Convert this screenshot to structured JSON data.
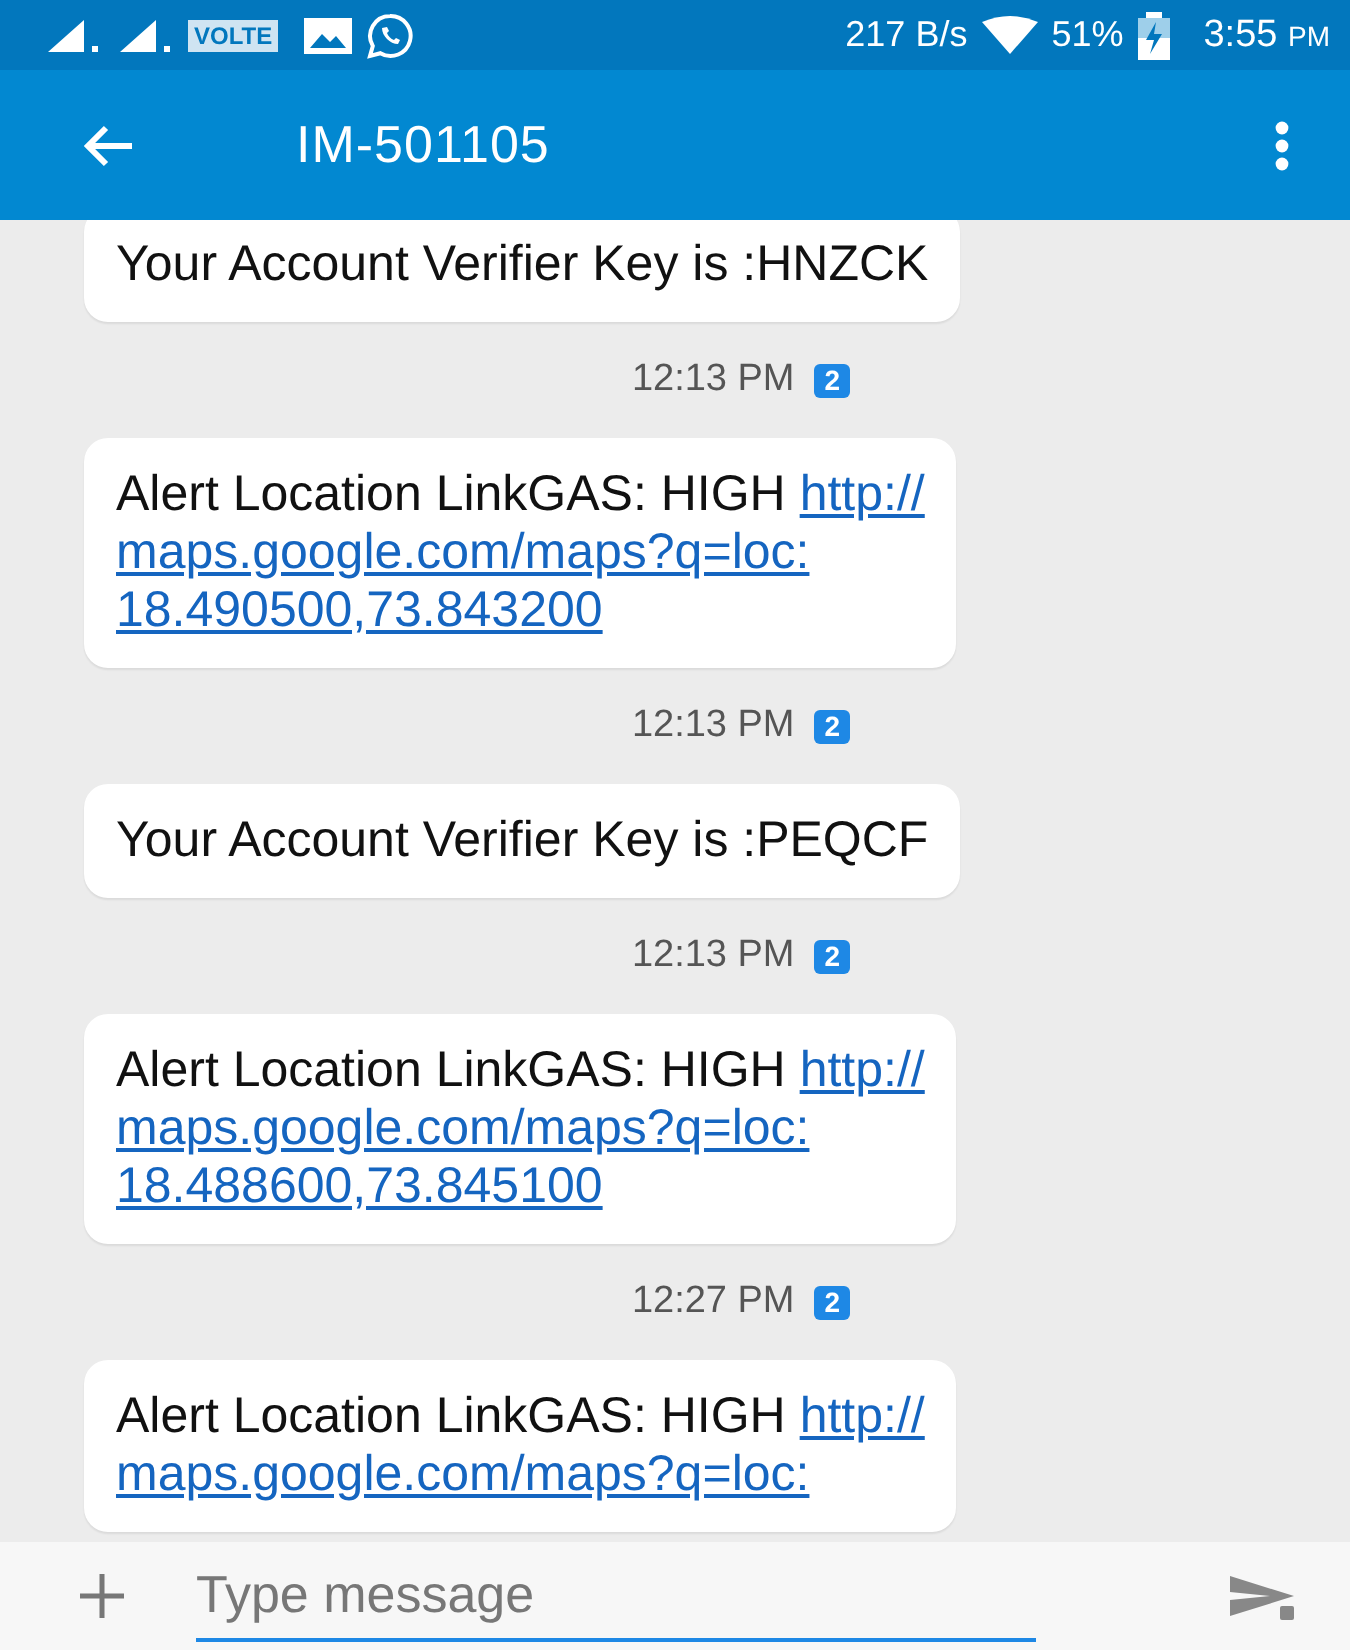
{
  "status_bar": {
    "network": "VOLTE",
    "speed": "217 B/s",
    "battery": "51%",
    "time": "3:55",
    "meridiem": "PM"
  },
  "toolbar": {
    "title": "IM-501105"
  },
  "conversation": [
    {
      "kind": "message",
      "text": "Your Account Verifier Key is :HNZCK"
    },
    {
      "kind": "timestamp",
      "time": "12:13 PM",
      "sim": "2"
    },
    {
      "kind": "message",
      "text": "Alert Location LinkGAS: HIGH",
      "link_lines": [
        "http://",
        "maps.google.com/maps?q=loc:",
        "18.490500,73.843200"
      ]
    },
    {
      "kind": "timestamp",
      "time": "12:13 PM",
      "sim": "2"
    },
    {
      "kind": "message",
      "text": "Your Account Verifier Key is :PEQCF"
    },
    {
      "kind": "timestamp",
      "time": "12:13 PM",
      "sim": "2"
    },
    {
      "kind": "message",
      "text": "Alert Location LinkGAS: HIGH",
      "link_lines": [
        "http://",
        "maps.google.com/maps?q=loc:",
        "18.488600,73.845100"
      ]
    },
    {
      "kind": "timestamp",
      "time": "12:27 PM",
      "sim": "2"
    },
    {
      "kind": "message",
      "text": "Alert Location LinkGAS: HIGH",
      "link_lines": [
        "http://",
        "maps.google.com/maps?q=loc:"
      ]
    }
  ],
  "composer": {
    "placeholder": "Type message"
  }
}
